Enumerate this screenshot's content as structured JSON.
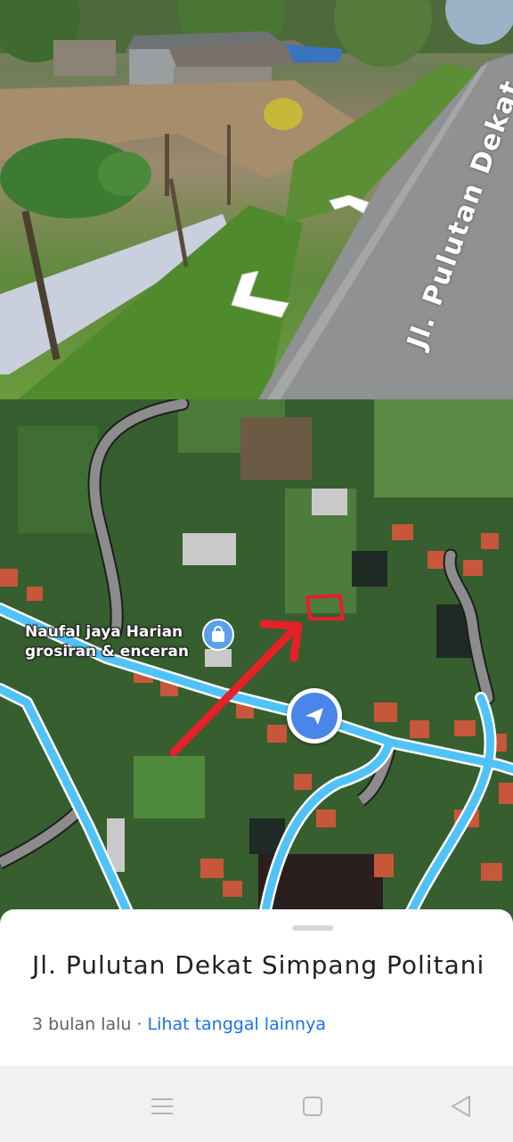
{
  "street_view": {
    "street_sign": "Jl. Pulutan Dekat"
  },
  "map": {
    "place_label_line1": "Naufal jaya Harian",
    "place_label_line2": "grosiran & enceran",
    "place_icon": "shopping-bag-icon",
    "location_button_icon": "navigation-arrow-icon",
    "annotation_color": "#e5202a",
    "road_color": "#4fc3f7"
  },
  "sheet": {
    "title": "Jl. Pulutan Dekat Simpang Politani",
    "date": "3 bulan lalu",
    "separator": "·",
    "link": "Lihat tanggal lainnya"
  },
  "navbar": {
    "items": [
      "menu-icon",
      "home-square-icon",
      "back-triangle-icon"
    ]
  }
}
